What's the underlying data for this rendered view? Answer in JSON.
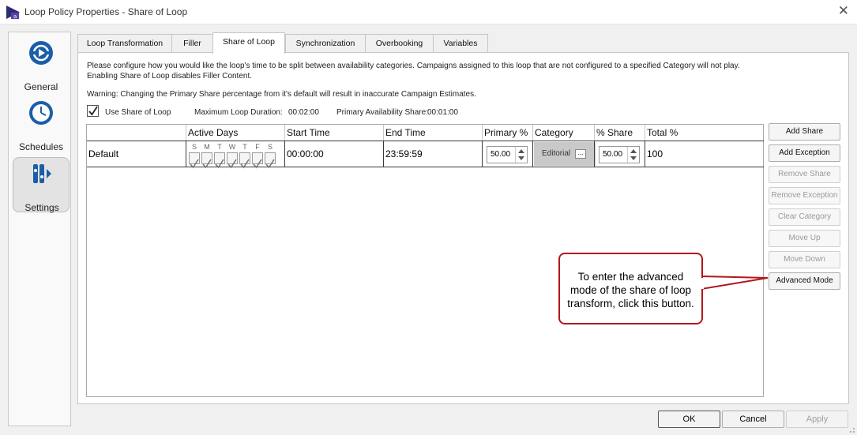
{
  "window": {
    "title": "Loop Policy Properties - Share of Loop",
    "close_icon": "close-icon"
  },
  "sidebar": {
    "items": [
      {
        "label": "General",
        "icon": "play-circle-icon",
        "selected": false
      },
      {
        "label": "Schedules",
        "icon": "clock-icon",
        "selected": false
      },
      {
        "label": "Settings",
        "icon": "settings-icon",
        "selected": true
      }
    ]
  },
  "tabs": [
    {
      "label": "Loop Transformation",
      "active": false
    },
    {
      "label": "Filler",
      "active": false
    },
    {
      "label": "Share of Loop",
      "active": true
    },
    {
      "label": "Synchronization",
      "active": false
    },
    {
      "label": "Overbooking",
      "active": false
    },
    {
      "label": "Variables",
      "active": false
    }
  ],
  "info": {
    "line1": "Please configure how you would like the loop's time to be split between availability categories. Campaigns assigned to this loop that are not configured to a specified Category will not play.",
    "line2": "Enabling Share of Loop disables Filler Content.",
    "warning": "Warning: Changing the Primary Share percentage from it's default will result in inaccurate Campaign Estimates."
  },
  "options": {
    "use_share_label": "Use Share of Loop",
    "use_share_checked": true,
    "max_loop_duration_label": "Maximum Loop Duration:",
    "max_loop_duration_value": "00:02:00",
    "primary_share_label": "Primary Availability Share:",
    "primary_share_value": "00:01:00"
  },
  "grid": {
    "columns": [
      "Active Days",
      "Start Time",
      "End Time",
      "Primary %",
      "Category",
      "% Share",
      "Total %"
    ],
    "day_letters": [
      "S",
      "M",
      "T",
      "W",
      "T",
      "F",
      "S"
    ],
    "rows": [
      {
        "name": "Default",
        "days_checked": [
          true,
          true,
          true,
          true,
          true,
          true,
          true
        ],
        "start_time": "00:00:00",
        "end_time": "23:59:59",
        "primary_pct": "50.00",
        "category": "Editorial",
        "category_btn": "...",
        "share_pct": "50.00",
        "total_pct": "100"
      }
    ]
  },
  "side_buttons": [
    {
      "label": "Add Share",
      "enabled": true
    },
    {
      "label": "Add Exception",
      "enabled": true
    },
    {
      "label": "Remove Share",
      "enabled": false
    },
    {
      "label": "Remove Exception",
      "enabled": false
    },
    {
      "label": "Clear Category",
      "enabled": false
    },
    {
      "label": "Move Up",
      "enabled": false
    },
    {
      "label": "Move Down",
      "enabled": false
    },
    {
      "label": "Advanced Mode",
      "enabled": true
    }
  ],
  "callout": {
    "line1": "To enter the advanced",
    "line2": "mode of the share of loop",
    "line3": "transform, click this button."
  },
  "footer": {
    "ok_label": "OK",
    "cancel_label": "Cancel",
    "apply_label": "Apply"
  },
  "colors": {
    "accent": "#1b5ea8",
    "callout_border": "#b3171c"
  }
}
